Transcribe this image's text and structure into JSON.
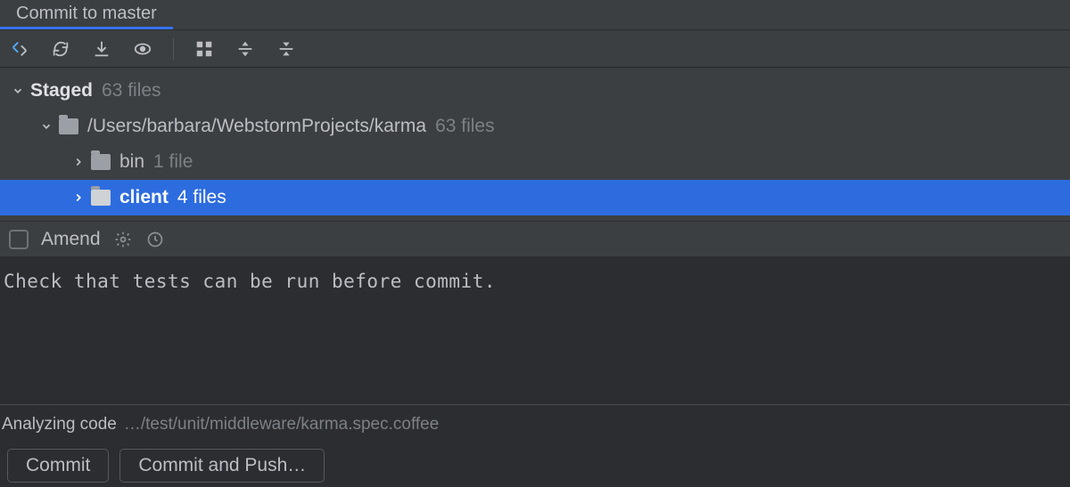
{
  "tab": {
    "title": "Commit to master"
  },
  "toolbar": {
    "icons": [
      "rollback",
      "refresh",
      "shelve",
      "preview",
      "group",
      "expand",
      "collapse"
    ]
  },
  "tree": {
    "root": {
      "label": "Staged",
      "count": "63 files"
    },
    "project": {
      "path": "/Users/barbara/WebstormProjects/karma",
      "count": "63 files"
    },
    "children": [
      {
        "name": "bin",
        "count": "1 file",
        "selected": false
      },
      {
        "name": "client",
        "count": "4 files",
        "selected": true
      }
    ]
  },
  "amend": {
    "label": "Amend"
  },
  "message": "Check that tests can be run before commit.",
  "status": {
    "label": "Analyzing code",
    "path": "…/test/unit/middleware/karma.spec.coffee"
  },
  "buttons": {
    "commit": "Commit",
    "commit_push": "Commit and Push…"
  }
}
